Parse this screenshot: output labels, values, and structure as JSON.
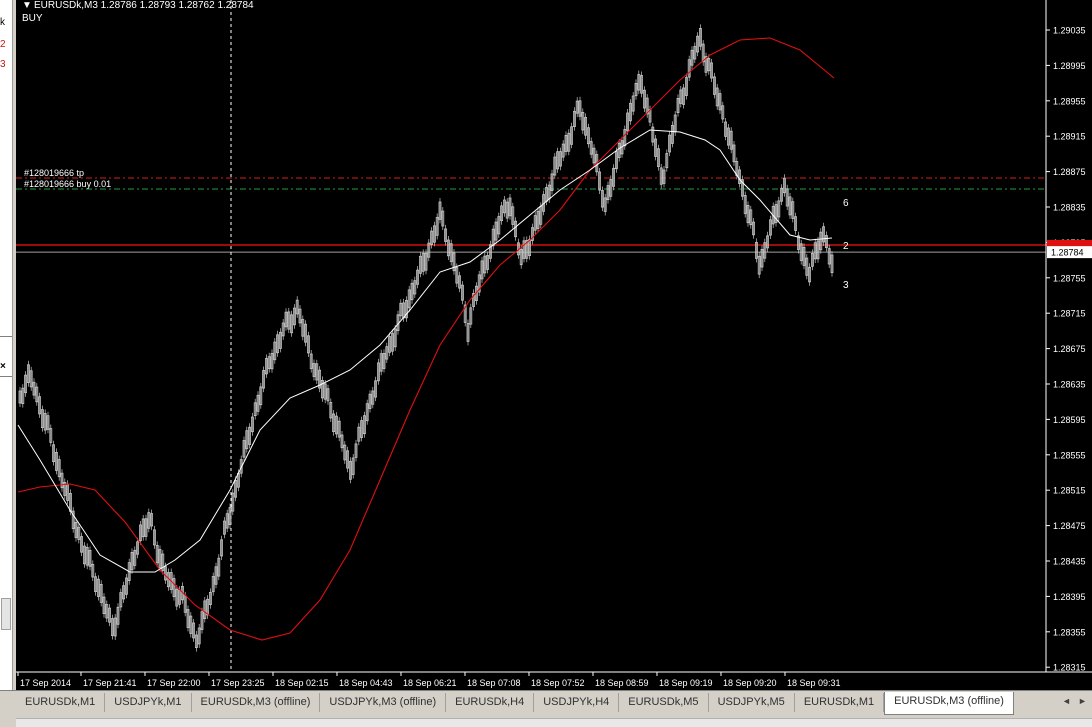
{
  "left_panel": {
    "labels": [
      "k",
      "2",
      "3"
    ],
    "close_glyph": "×"
  },
  "chart_header": {
    "symbol_line": "EURUSDk,M3  1.28786 1.28793 1.28762 1.28784",
    "signal": "BUY",
    "dropdown_glyph": "▼"
  },
  "price_axis": {
    "ticks": [
      "1.29035",
      "1.28995",
      "1.28955",
      "1.28915",
      "1.28875",
      "1.28835",
      "1.28795",
      "1.28755",
      "1.28715",
      "1.28675",
      "1.28635",
      "1.28595",
      "1.28555",
      "1.28515",
      "1.28475",
      "1.28435",
      "1.28395",
      "1.28355",
      "1.28315"
    ],
    "current_price": "1.28784"
  },
  "time_axis": {
    "labels": [
      "17 Sep 2014",
      "17 Sep 21:41",
      "17 Sep 22:00",
      "17 Sep 23:25",
      "18 Sep 02:15",
      "18 Sep 04:43",
      "18 Sep 06:21",
      "18 Sep 07:08",
      "18 Sep 07:52",
      "18 Sep 08:59",
      "18 Sep 09:19",
      "18 Sep 09:20",
      "18 Sep 09:31"
    ]
  },
  "order_lines": {
    "tp_label": "#128019666 tp",
    "buy_label": "#128019666 buy 0.01"
  },
  "markers": [
    "6",
    "2",
    "3"
  ],
  "colors": {
    "background": "#000000",
    "candles": "#c8c8c8",
    "ma_fast": "#ffffff",
    "ma_slow": "#e01010",
    "tp_line": "#d02020",
    "buy_line": "#20a040",
    "price_line": "#d01010",
    "bid_line": "#a0a0a0"
  },
  "tabs": [
    {
      "label": "EURUSDk,M1",
      "active": false
    },
    {
      "label": "USDJPYk,M1",
      "active": false
    },
    {
      "label": "EURUSDk,M3 (offline)",
      "active": false
    },
    {
      "label": "USDJPYk,M3 (offline)",
      "active": false
    },
    {
      "label": "EURUSDk,H4",
      "active": false
    },
    {
      "label": "USDJPYk,H4",
      "active": false
    },
    {
      "label": "EURUSDk,M5",
      "active": false
    },
    {
      "label": "USDJPYk,M5",
      "active": false
    },
    {
      "label": "EURUSDk,M1",
      "active": false
    },
    {
      "label": "EURUSDk,M3 (offline)",
      "active": true
    }
  ],
  "tab_nav": {
    "left": "◄",
    "right": "►"
  }
}
